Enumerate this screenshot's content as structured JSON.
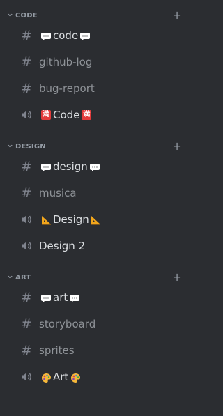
{
  "categories": [
    {
      "name": "CODE",
      "channels": [
        {
          "type": "text",
          "prefix_emoji": "speech-bubble",
          "name": "code",
          "suffix_emoji": "speech-bubble"
        },
        {
          "type": "text",
          "name": "github-log"
        },
        {
          "type": "text",
          "name": "bug-report"
        },
        {
          "type": "voice",
          "prefix_emoji": "manji-square",
          "name": "Code",
          "suffix_emoji": "manji-square",
          "emoji_char": "満"
        }
      ]
    },
    {
      "name": "DESIGN",
      "channels": [
        {
          "type": "text",
          "prefix_emoji": "speech-bubble",
          "name": "design",
          "suffix_emoji": "speech-bubble"
        },
        {
          "type": "text",
          "name": "musica"
        },
        {
          "type": "voice",
          "prefix_emoji": "triangular-ruler",
          "name": "Design",
          "suffix_emoji": "triangular-ruler"
        },
        {
          "type": "voice",
          "name": "Design 2"
        }
      ]
    },
    {
      "name": "ART",
      "channels": [
        {
          "type": "text",
          "prefix_emoji": "speech-bubble",
          "name": "art",
          "suffix_emoji": "speech-bubble"
        },
        {
          "type": "text",
          "name": "storyboard"
        },
        {
          "type": "text",
          "name": "sprites"
        },
        {
          "type": "voice",
          "prefix_emoji": "artist-palette",
          "name": "Art",
          "suffix_emoji": "artist-palette"
        }
      ]
    }
  ],
  "symbols": {
    "hash": "#",
    "plus": "+"
  },
  "colors": {
    "background": "#2b2d31",
    "category_text": "#949ba4",
    "channel_text": "#8e9297",
    "active_text": "#dbdee1",
    "icon": "#80848e"
  }
}
